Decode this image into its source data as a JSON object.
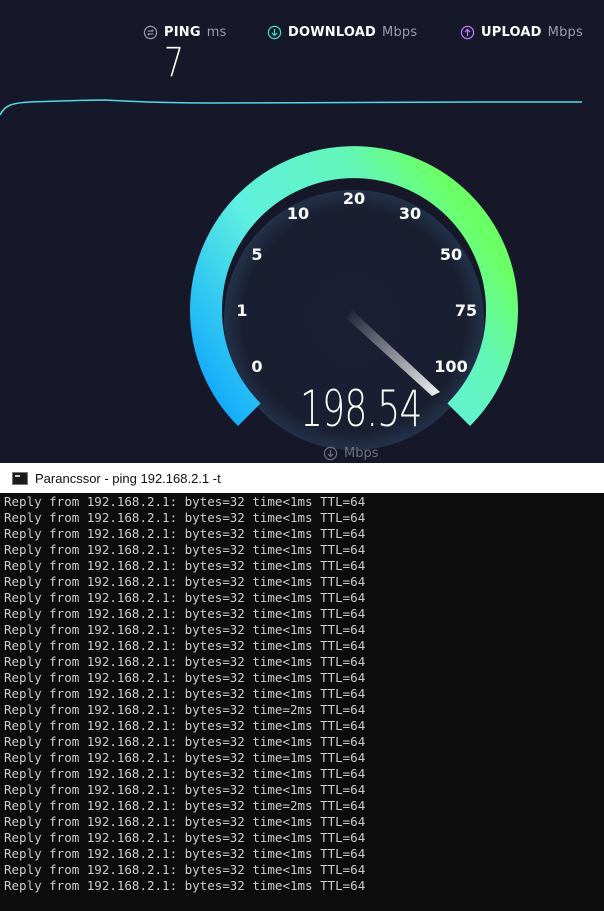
{
  "speedtest": {
    "ping": {
      "label": "PING",
      "unit": "ms",
      "value": "7"
    },
    "download": {
      "label": "DOWNLOAD",
      "unit": "Mbps"
    },
    "upload": {
      "label": "UPLOAD",
      "unit": "Mbps"
    },
    "gauge": {
      "ticks": [
        "0",
        "1",
        "5",
        "10",
        "20",
        "30",
        "50",
        "75",
        "100"
      ],
      "reading": "198.54",
      "unit": "Mbps"
    },
    "colors": {
      "download_icon": "#3fe0d0",
      "upload_icon": "#c27aff",
      "gauge_start": "#13a7ff",
      "gauge_mid": "#62f2d6",
      "gauge_end": "#6dff6b",
      "graph_line": "#50d9e8"
    }
  },
  "console": {
    "title": "Parancssor - ping  192.168.2.1 -t",
    "lines": [
      "Reply from 192.168.2.1: bytes=32 time<1ms TTL=64",
      "Reply from 192.168.2.1: bytes=32 time<1ms TTL=64",
      "Reply from 192.168.2.1: bytes=32 time<1ms TTL=64",
      "Reply from 192.168.2.1: bytes=32 time<1ms TTL=64",
      "Reply from 192.168.2.1: bytes=32 time<1ms TTL=64",
      "Reply from 192.168.2.1: bytes=32 time<1ms TTL=64",
      "Reply from 192.168.2.1: bytes=32 time<1ms TTL=64",
      "Reply from 192.168.2.1: bytes=32 time<1ms TTL=64",
      "Reply from 192.168.2.1: bytes=32 time<1ms TTL=64",
      "Reply from 192.168.2.1: bytes=32 time<1ms TTL=64",
      "Reply from 192.168.2.1: bytes=32 time<1ms TTL=64",
      "Reply from 192.168.2.1: bytes=32 time<1ms TTL=64",
      "Reply from 192.168.2.1: bytes=32 time<1ms TTL=64",
      "Reply from 192.168.2.1: bytes=32 time=2ms TTL=64",
      "Reply from 192.168.2.1: bytes=32 time<1ms TTL=64",
      "Reply from 192.168.2.1: bytes=32 time<1ms TTL=64",
      "Reply from 192.168.2.1: bytes=32 time=1ms TTL=64",
      "Reply from 192.168.2.1: bytes=32 time<1ms TTL=64",
      "Reply from 192.168.2.1: bytes=32 time<1ms TTL=64",
      "Reply from 192.168.2.1: bytes=32 time=2ms TTL=64",
      "Reply from 192.168.2.1: bytes=32 time<1ms TTL=64",
      "Reply from 192.168.2.1: bytes=32 time<1ms TTL=64",
      "Reply from 192.168.2.1: bytes=32 time<1ms TTL=64",
      "Reply from 192.168.2.1: bytes=32 time<1ms TTL=64",
      "Reply from 192.168.2.1: bytes=32 time<1ms TTL=64"
    ]
  }
}
